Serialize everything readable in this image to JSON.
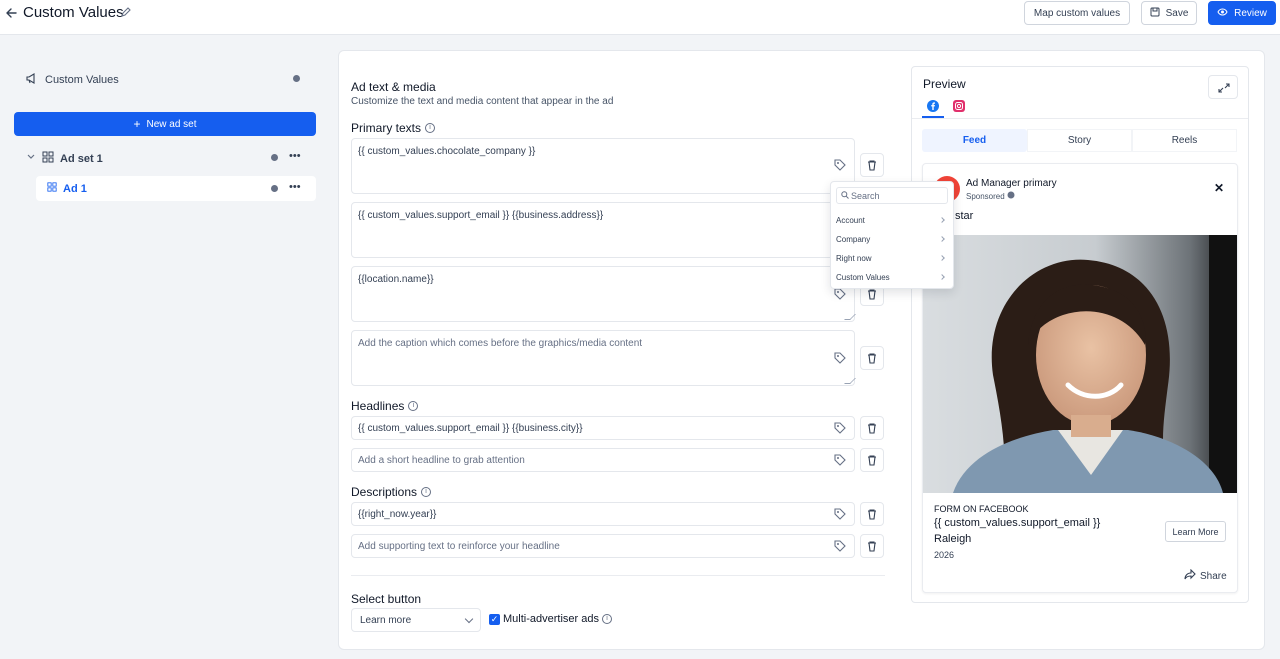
{
  "header": {
    "title": "Custom Values",
    "map_button": "Map custom values",
    "save_button": "Save",
    "review_button": "Review"
  },
  "sidebar": {
    "title": "Custom Values",
    "new_adset_button": "New ad set",
    "adset_label": "Ad set 1",
    "ad_label": "Ad 1"
  },
  "main": {
    "section_title": "Ad text & media",
    "section_subtitle": "Customize the text and media content that appear in the ad",
    "primary_label": "Primary texts",
    "primary_texts": [
      "{{ custom_values.chocolate_company }}",
      "{{ custom_values.support_email }} {{business.address}}",
      "{{location.name}}"
    ],
    "primary_placeholder": "Add the caption which comes before the graphics/media content",
    "headlines_label": "Headlines",
    "headline_value": "{{ custom_values.support_email }}  {{business.city}}",
    "headline_placeholder": "Add a short headline to grab attention",
    "descriptions_label": "Descriptions",
    "description_value": "{{right_now.year}}",
    "description_placeholder": "Add supporting text to reinforce your headline",
    "select_button_label": "Select button",
    "select_value": "Learn more",
    "multi_advertiser_label": "Multi-advertiser ads",
    "multi_advertiser_checked": true
  },
  "menu": {
    "search_placeholder": "Search",
    "items": [
      "Account",
      "Company",
      "Right now",
      "Custom Values"
    ]
  },
  "preview": {
    "title": "Preview",
    "tabs": [
      "Feed",
      "Story",
      "Reels"
    ],
    "active_tab": "Feed",
    "account_name": "Ad Manager primary",
    "sponsored": "Sponsored",
    "caption_fragment": "star",
    "source": "FORM ON FACEBOOK",
    "headline": "{{ custom_values.support_email }}",
    "line2": "Raleigh",
    "line3": "2026",
    "cta": "Learn More",
    "share": "Share"
  },
  "colors": {
    "accent": "#155eef",
    "avatar": "#f04438",
    "facebook": "#1877f2",
    "instagram": "#e1306c"
  }
}
